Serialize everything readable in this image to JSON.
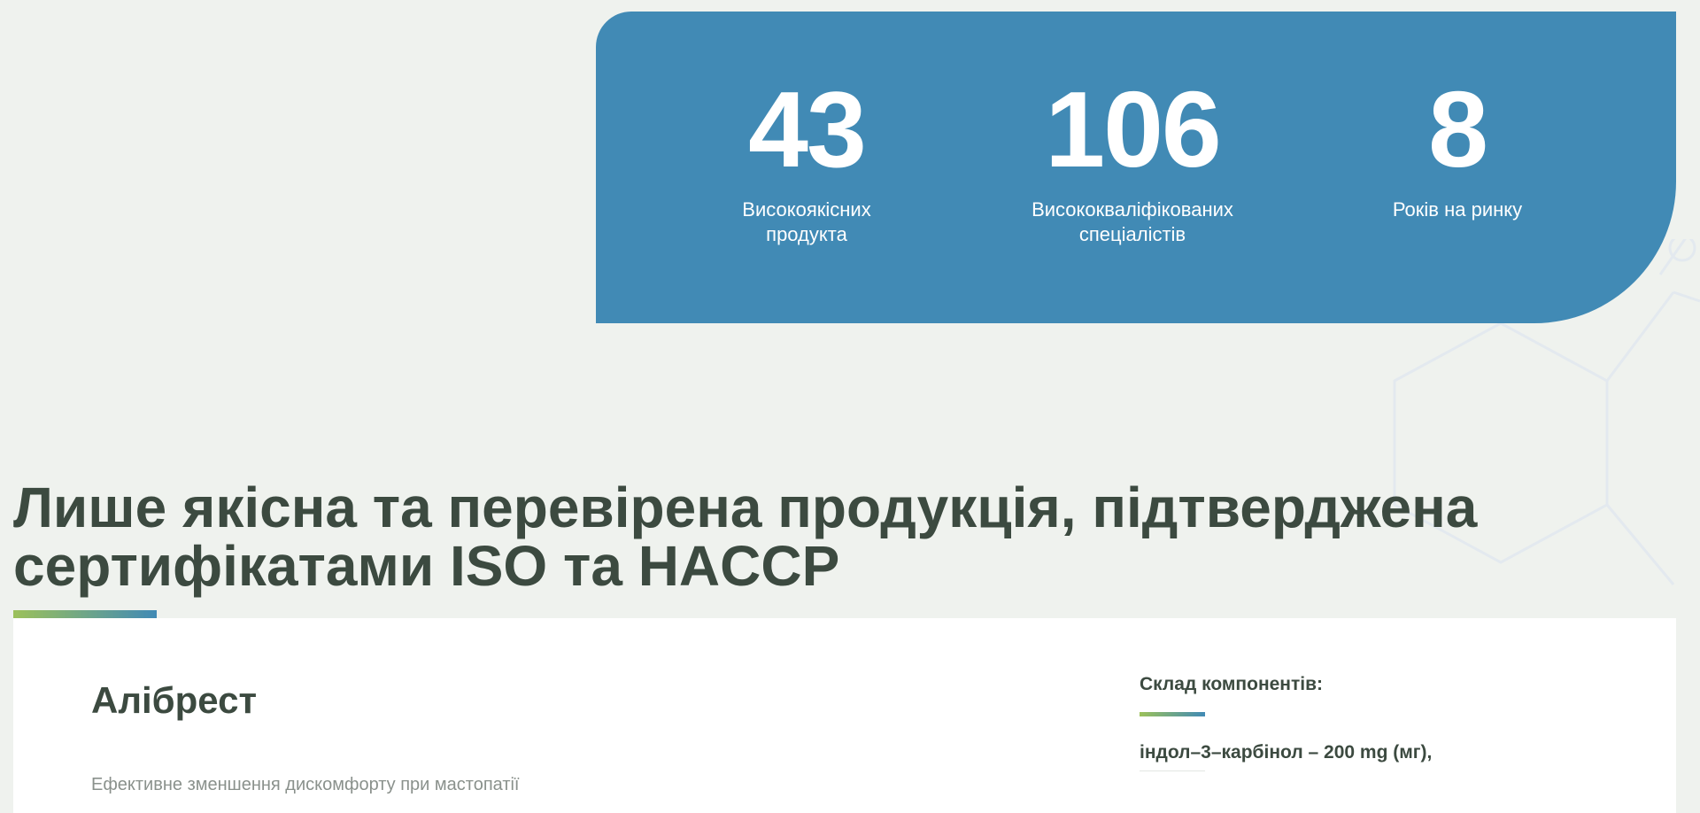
{
  "stats": [
    {
      "number": "43",
      "label": "Високоякісних\nпродукта"
    },
    {
      "number": "106",
      "label": "Висококваліфікованих\nспеціалістів"
    },
    {
      "number": "8",
      "label": "Років на ринку"
    }
  ],
  "quality_heading": "Лише якісна та перевірена продукція, підтверджена сертифікатами ISO та HACCP",
  "product": {
    "name": "Алібрест",
    "description": "Ефективне зменшення дискомфорту при мастопатії",
    "components_title": "Склад компонентів:",
    "components": [
      "індол–3–карбінол – 200 mg (мг),"
    ]
  },
  "colors": {
    "background": "#eff2ee",
    "stats_panel": "#418ab5",
    "heading_text": "#3c4a40",
    "accent_green": "#9cc15a",
    "accent_blue": "#418ab5"
  }
}
